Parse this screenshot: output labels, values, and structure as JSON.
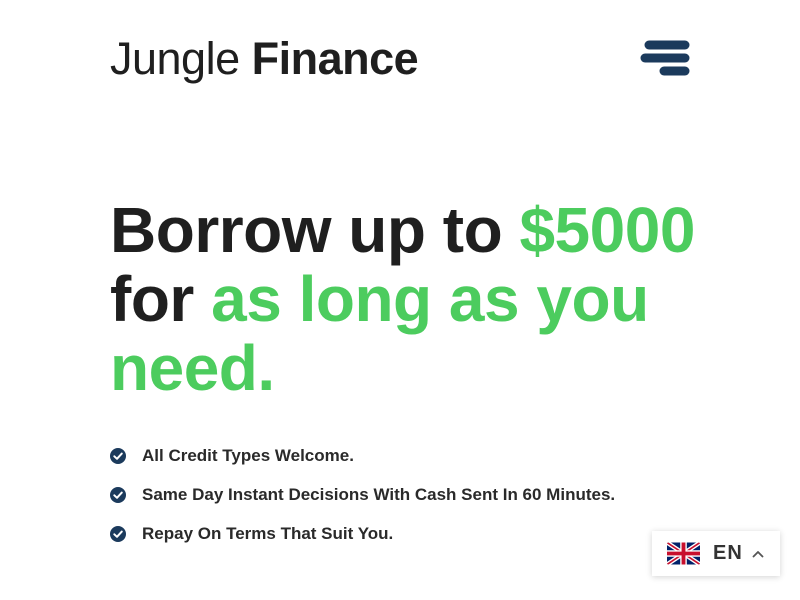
{
  "header": {
    "brand_regular": "Jungle",
    "brand_bold": "Finance",
    "menu_icon": "hamburger-menu-icon"
  },
  "hero": {
    "line1_plain": "Borrow up to ",
    "line1_accent": "$5000",
    "line2_plain": "for ",
    "line2_accent": "as long as you need."
  },
  "features": [
    {
      "icon": "check-circle-icon",
      "text": "All Credit Types Welcome."
    },
    {
      "icon": "check-circle-icon",
      "text": "Same Day Instant Decisions With Cash Sent In 60 Minutes."
    },
    {
      "icon": "check-circle-icon",
      "text": "Repay On Terms That Suit You."
    }
  ],
  "language_switcher": {
    "flag_icon": "uk-flag-icon",
    "code": "EN",
    "caret_icon": "chevron-up-icon"
  },
  "colors": {
    "accent_green": "#4ccc5e",
    "navy": "#1b3a5c",
    "text_dark": "#1f1f1f"
  }
}
